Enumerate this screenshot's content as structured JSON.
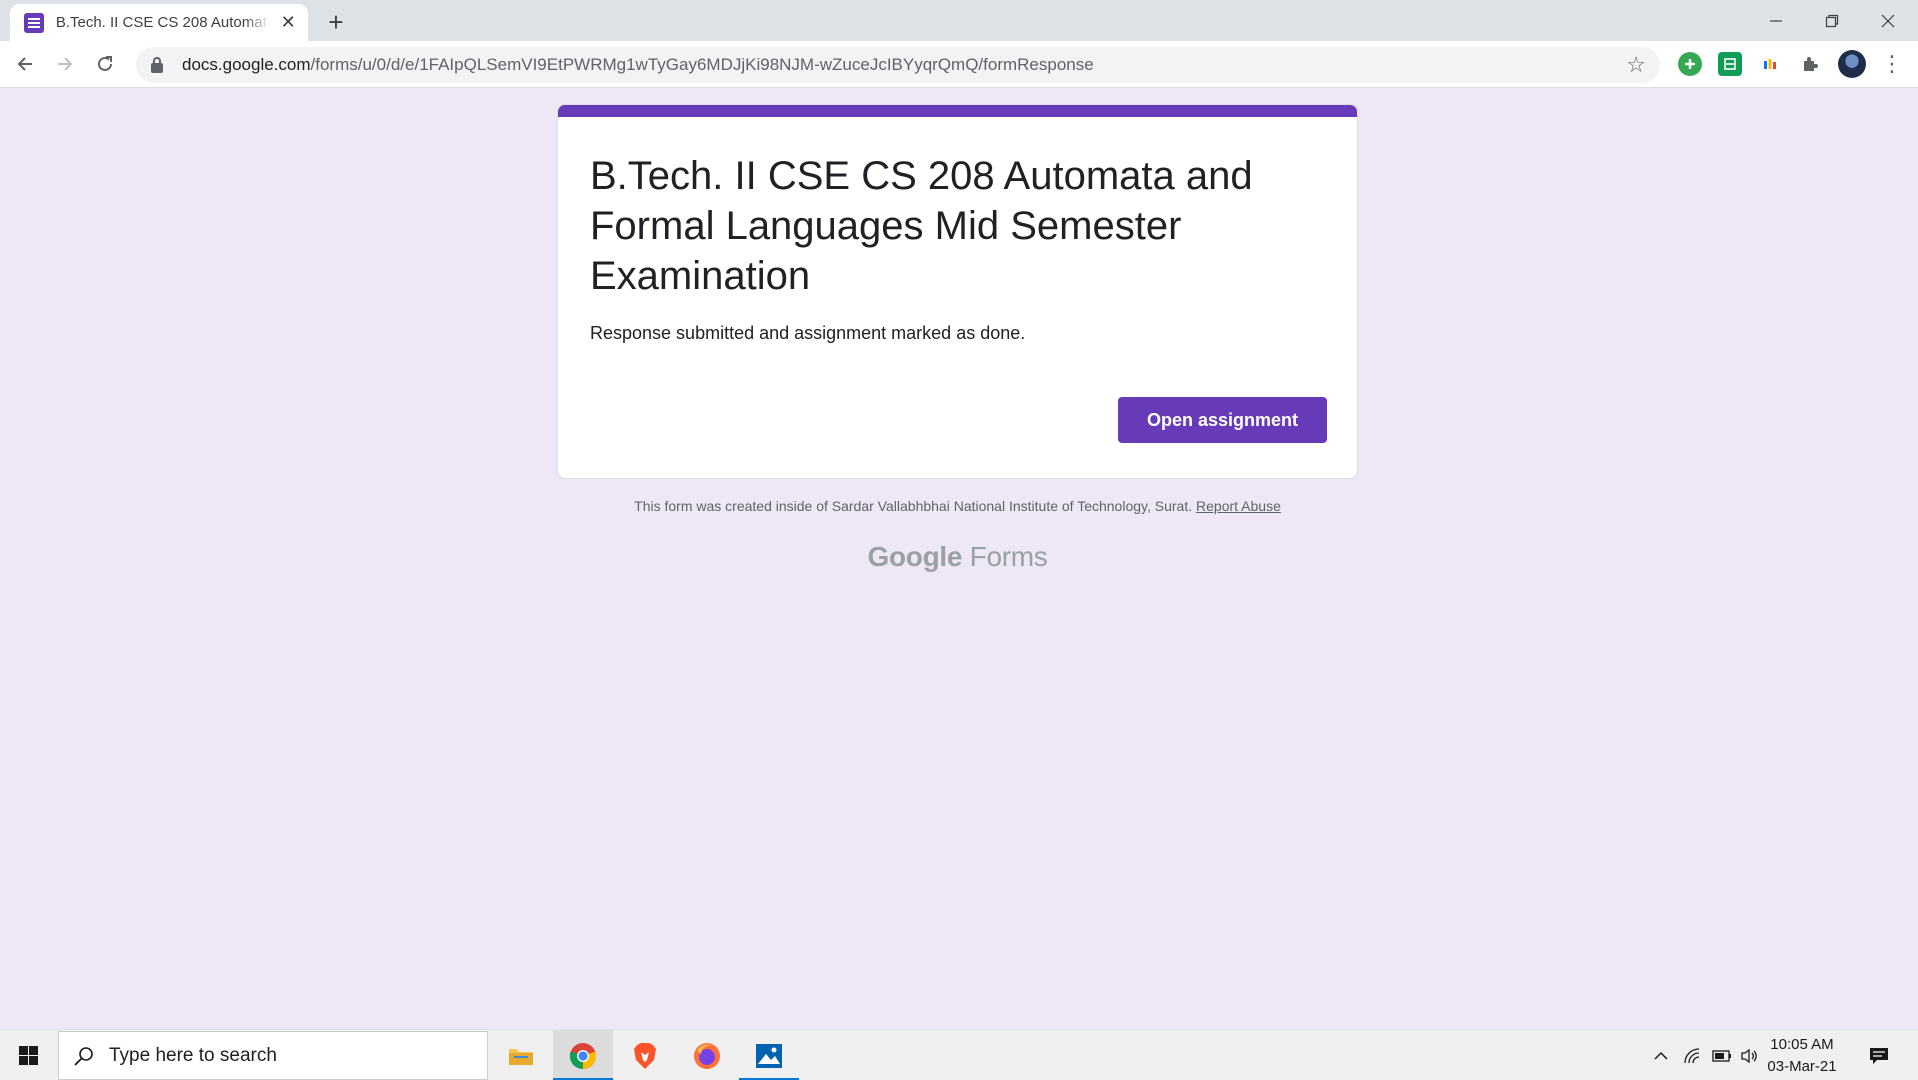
{
  "browser": {
    "tab_title": "B.Tech. II CSE CS 208 Automata and Formal Languages Mid Semester Examination",
    "url_host": "docs.google.com",
    "url_path": "/forms/u/0/d/e/1FAIpQLSemVI9EtPWRMg1wTyGay6MDJjKi98NJM-wZuceJcIBYyqrQmQ/formResponse",
    "icons": [
      "back-icon",
      "forward-icon",
      "reload-icon",
      "lock-icon",
      "star-icon",
      "extensions-icon",
      "menu-icon"
    ]
  },
  "form": {
    "title": "B.Tech. II CSE CS 208 Automata and Formal Languages Mid Semester Examination",
    "confirmation": "Response submitted and assignment marked as done.",
    "open_button": "Open assignment",
    "accent_color": "#673ab7"
  },
  "footer": {
    "note": "This form was created inside of Sardar Vallabhbhai National Institute of Technology, Surat.",
    "report_abuse": "Report Abuse",
    "brand_google": "Google",
    "brand_forms": "Forms"
  },
  "taskbar": {
    "search_placeholder": "Type here to search",
    "time": "10:05 AM",
    "date": "03-Mar-21"
  }
}
